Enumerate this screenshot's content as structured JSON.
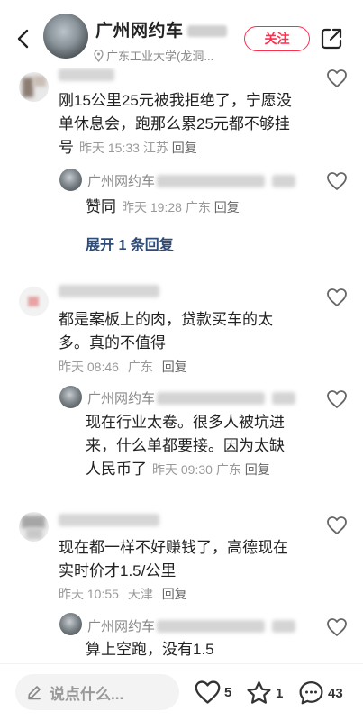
{
  "header": {
    "title": "广州网约车",
    "location": "广东工业大学(龙洞...",
    "follow_label": "关注"
  },
  "comments": [
    {
      "text": "刚15公里25元被我拒绝了，宁愿没单休息会，跑那么累25元都不够挂号",
      "line1": "刚15公里25元被我拒绝了，宁愿没",
      "line2": "单休息会，跑那么累25元都不够挂",
      "line3": "号",
      "time": "昨天 15:33",
      "region": "江苏",
      "reply": "回复"
    },
    {
      "author": "广州网约车",
      "text": "赞同",
      "time": "昨天 19:28",
      "region": "广东",
      "reply": "回复"
    },
    {
      "expand": "展开 1 条回复"
    },
    {
      "line1": "都是案板上的肉，贷款买车的太",
      "line2": "多。真的不值得",
      "time": "昨天 08:46",
      "region": "广东",
      "reply": "回复"
    },
    {
      "author": "广州网约车",
      "line1": "现在行业太卷。很多人被坑进",
      "line2": "来，什么单都要接。因为太缺",
      "line3": "人民币了",
      "time": "昨天 09:30",
      "region": "广东",
      "reply": "回复"
    },
    {
      "line1": "现在都一样不好赚钱了，高德现在",
      "line2": "实时价才1.5/公里",
      "time": "昨天 10:55",
      "region": "天津",
      "reply": "回复"
    },
    {
      "author": "广州网约车",
      "line1": "算上空跑，没有1.5"
    }
  ],
  "bottom": {
    "input_placeholder": "说点什么...",
    "like_count": "5",
    "star_count": "1",
    "comment_count": "43"
  },
  "colors": {
    "accent": "#ff2e4d",
    "expand_link": "#2f4b78"
  }
}
